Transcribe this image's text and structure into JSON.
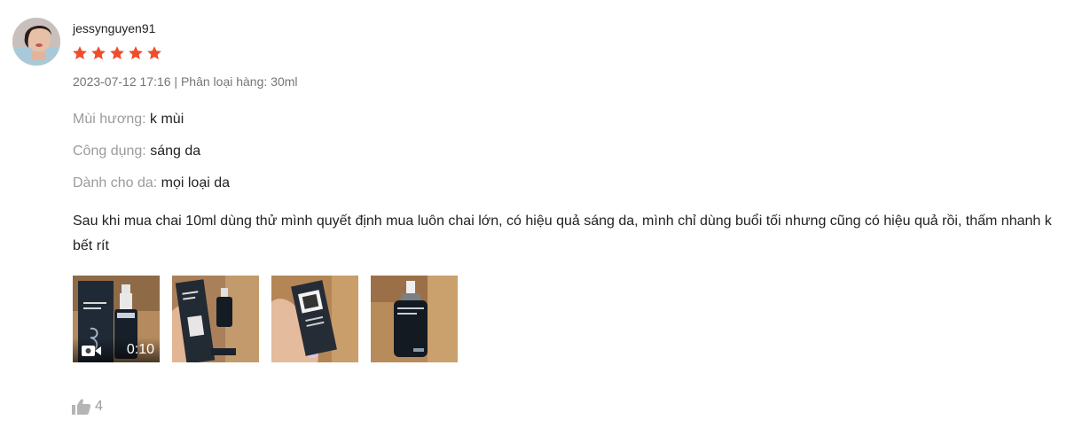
{
  "review": {
    "username": "jessynguyen91",
    "rating": 5,
    "star_color": "#ee4d2d",
    "date": "2023-07-12 17:16",
    "separator": " | ",
    "variation": "Phân loại hàng: 30ml",
    "attributes": [
      {
        "key": "Mùi hương:",
        "value": "k mùi"
      },
      {
        "key": "Công dụng:",
        "value": "sáng da"
      },
      {
        "key": "Dành cho da:",
        "value": "mọi loại da"
      }
    ],
    "comment": "Sau khi mua chai 10ml dùng thử mình quyết định mua luôn chai lớn, có hiệu quả sáng da, mình chỉ dùng buổi tối nhưng cũng có hiệu quả rồi, thấm nhanh k bết rít",
    "media": [
      {
        "kind": "video",
        "duration": "0:10",
        "icon": "video-camera-icon"
      },
      {
        "kind": "image"
      },
      {
        "kind": "image"
      },
      {
        "kind": "image"
      }
    ],
    "likes": "4",
    "like_icon": "thumbs-up-icon"
  }
}
